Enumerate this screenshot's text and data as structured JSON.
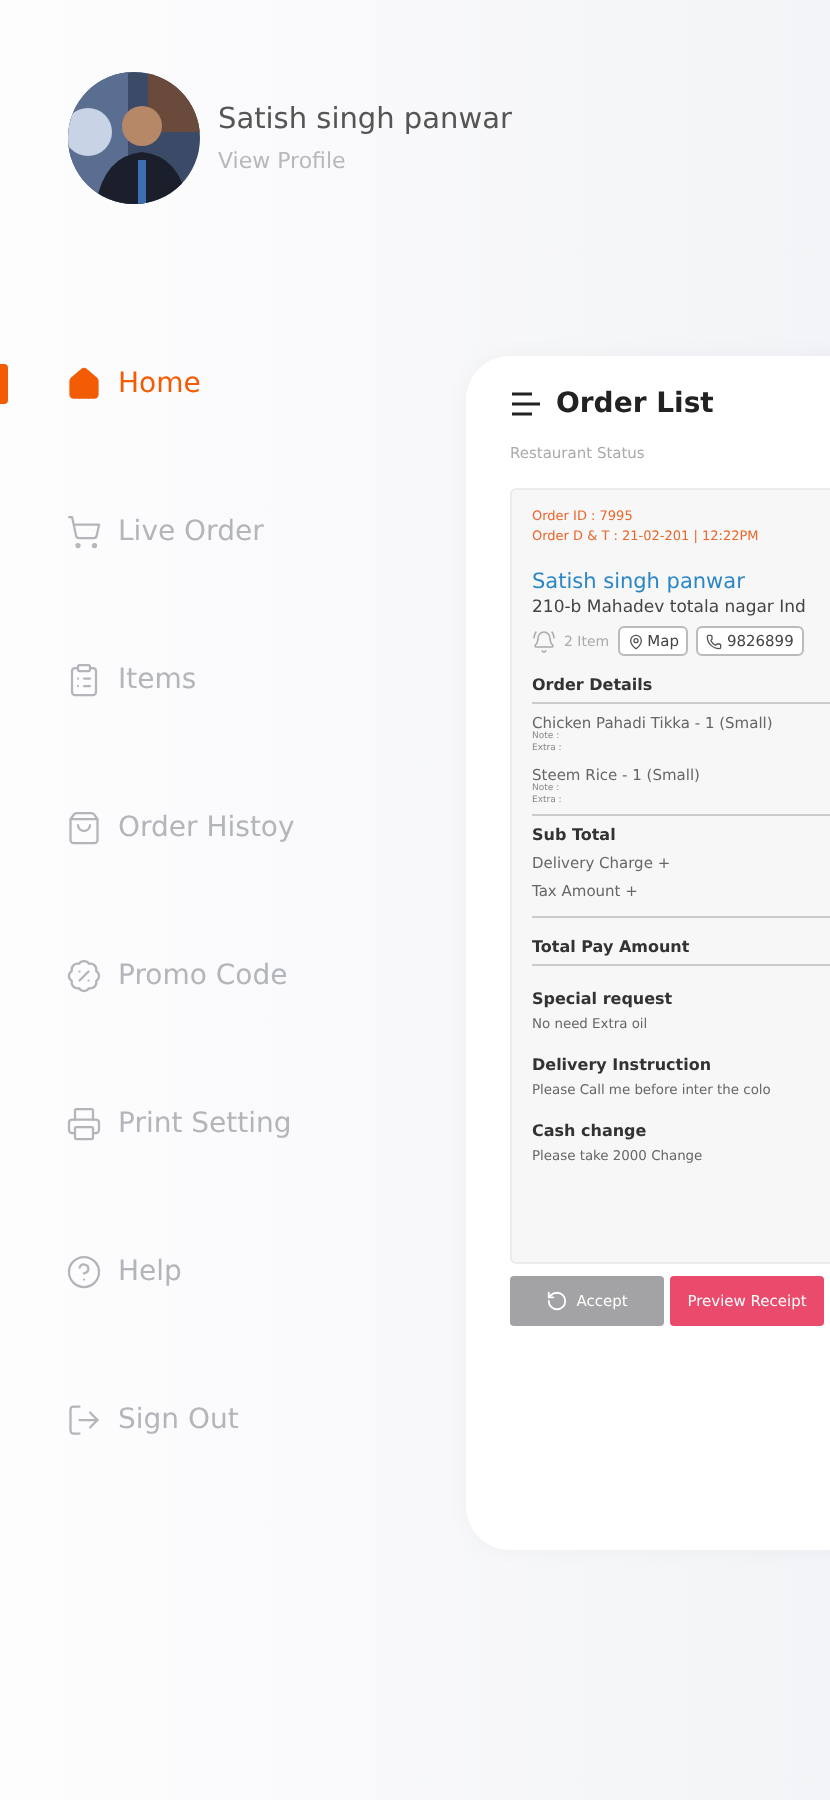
{
  "profile": {
    "name": "Satish singh panwar",
    "link": "View Profile"
  },
  "menu": [
    {
      "label": "Home",
      "selected": true
    },
    {
      "label": "Live Order",
      "selected": false
    },
    {
      "label": "Items",
      "selected": false
    },
    {
      "label": "Order Histoy",
      "selected": false
    },
    {
      "label": "Promo Code",
      "selected": false
    },
    {
      "label": "Print Setting",
      "selected": false
    },
    {
      "label": "Help",
      "selected": false
    },
    {
      "label": "Sign Out",
      "selected": false
    }
  ],
  "screen": {
    "title": "Order List",
    "subtitle": "Restaurant Status",
    "order": {
      "id": "Order ID : 7995",
      "datetime": "Order D & T : 21-02-201 | 12:22PM",
      "customer": "Satish singh panwar",
      "address": "210-b Mahadev totala nagar Ind",
      "items_count": "2 Item",
      "map": "Map",
      "phone": "9826899",
      "details_title": "Order Details",
      "items": [
        {
          "name": "Chicken Pahadi Tikka - 1 (Small)",
          "notes": [
            "Note :",
            "Extra :"
          ]
        },
        {
          "name": "Steem Rice - 1 (Small)",
          "notes": [
            "Note :",
            "Extra :"
          ]
        }
      ],
      "subtotal": "Sub Total",
      "charges": [
        "Delivery Charge +",
        "Tax Amount +"
      ],
      "total": "Total Pay Amount",
      "notes": [
        {
          "title": "Special request",
          "text": "No need Extra oil"
        },
        {
          "title": "Delivery Instruction",
          "text": "Please Call me before inter the colo"
        },
        {
          "title": "Cash change",
          "text": "Please take 2000 Change"
        }
      ]
    },
    "buttons": [
      {
        "label": "Accept",
        "kind": "accept"
      },
      {
        "label": "Preview Receipt",
        "kind": "preview"
      }
    ]
  }
}
